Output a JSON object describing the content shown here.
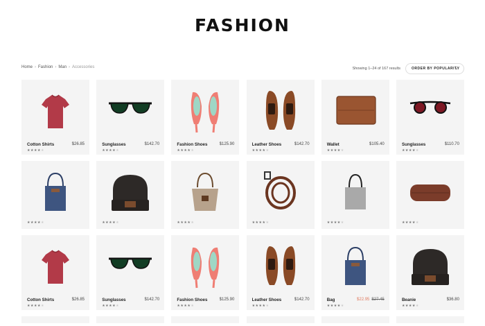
{
  "site": {
    "title": "FASHION"
  },
  "breadcrumb": [
    "Home",
    "Fashion",
    "Man",
    "Accessories"
  ],
  "result_count": "Showing 1–24 of 167 results",
  "order": {
    "label": "ORDER BY POPULARITY"
  },
  "rating_icon": "star-icon",
  "colors": {
    "sale_price": "#e07a5f",
    "card_background": "#f4f4f4"
  },
  "products": [
    {
      "name": "Cotton Shirts",
      "price": "$26.85",
      "rating": 4,
      "image": "red-tshirt"
    },
    {
      "name": "Sunglasses",
      "price": "$142.70",
      "rating": 4,
      "image": "green-sunglasses"
    },
    {
      "name": "Fashion Shoes",
      "price": "$125.90",
      "rating": 4,
      "image": "coral-heels"
    },
    {
      "name": "Leather Shoes",
      "price": "$142.70",
      "rating": 4,
      "image": "brown-brogues"
    },
    {
      "name": "Wallet",
      "price": "$105.40",
      "rating": 4,
      "image": "brown-wallet"
    },
    {
      "name": "Sunglasses",
      "price": "$110.70",
      "rating": 4,
      "image": "red-sunglasses"
    },
    {
      "name": "",
      "price": "",
      "rating": 4,
      "image": "blue-tote"
    },
    {
      "name": "",
      "price": "",
      "rating": 4,
      "image": "black-beanie"
    },
    {
      "name": "",
      "price": "",
      "rating": 4,
      "image": "woven-bag"
    },
    {
      "name": "",
      "price": "",
      "rating": 4,
      "image": "leather-belt"
    },
    {
      "name": "",
      "price": "",
      "rating": 4,
      "image": "grey-tote"
    },
    {
      "name": "",
      "price": "",
      "rating": 4,
      "image": "glasses-case"
    },
    {
      "name": "Cotton Shirts",
      "price": "$26.85",
      "rating": 4,
      "image": "red-tshirt"
    },
    {
      "name": "Sunglasses",
      "price": "$142.70",
      "rating": 4,
      "image": "green-sunglasses"
    },
    {
      "name": "Fashion Shoes",
      "price": "$125.90",
      "rating": 4,
      "image": "coral-heels"
    },
    {
      "name": "Leather Shoes",
      "price": "$142.70",
      "rating": 4,
      "image": "brown-brogues"
    },
    {
      "name": "Bag",
      "sale_price": "$22.95",
      "old_price": "$27.45",
      "rating": 4,
      "image": "blue-tote"
    },
    {
      "name": "Beanie",
      "price": "$36.80",
      "rating": 4,
      "image": "black-beanie"
    }
  ]
}
